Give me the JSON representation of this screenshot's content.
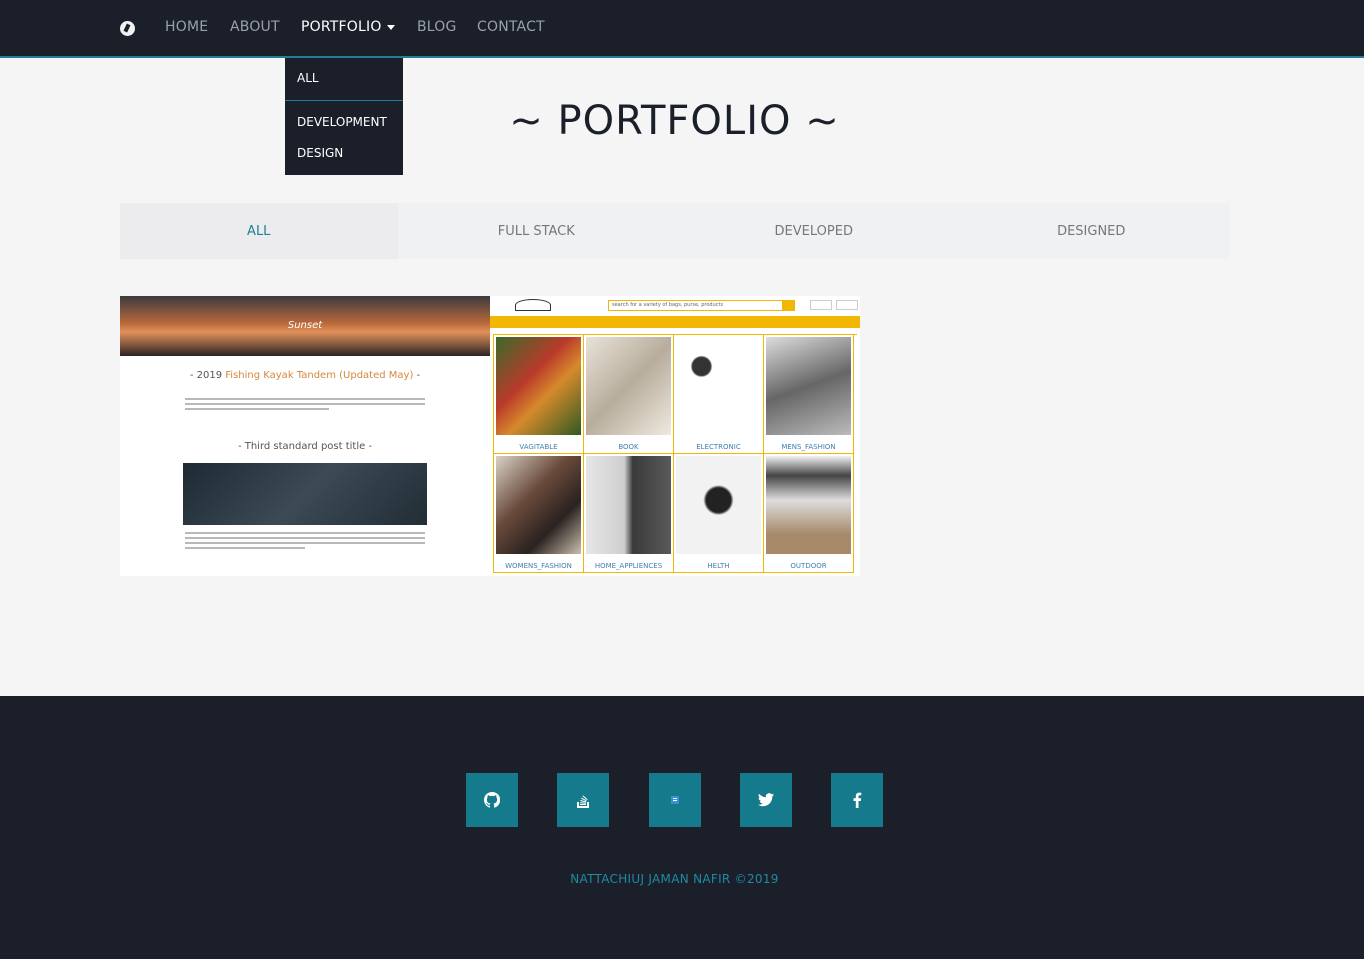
{
  "nav": {
    "logo_icon": "brand-logo-icon",
    "links": [
      "HOME",
      "ABOUT",
      "PORTFOLIO",
      "BLOG",
      "CONTACT"
    ],
    "active": "PORTFOLIO"
  },
  "dropdown": {
    "items": [
      "ALL",
      "DEVELOPMENT",
      "DESIGN"
    ]
  },
  "page": {
    "title": "~ PORTFOLIO ~"
  },
  "filters": {
    "tabs": [
      "ALL",
      "FULL STACK",
      "DEVELOPED",
      "DESIGNED"
    ],
    "active": "ALL"
  },
  "gallery": {
    "blog": {
      "brand": "Sunset",
      "post1_prefix": "- 2019 ",
      "post1_accent": "Fishing Kayak Tandem (Updated May)",
      "post1_suffix": " -",
      "post2": "- Third standard post title -"
    },
    "shop": {
      "search_placeholder": "search for a variety of bags, purse, products",
      "categories": [
        "VAGITABLE",
        "BOOK",
        "ELECTRONIC",
        "MENS_FASHION",
        "WOMENS_FASHION",
        "HOME_APPLIENCES",
        "HELTH",
        "OUTDOOR"
      ]
    }
  },
  "footer": {
    "social": [
      "github-icon",
      "stackoverflow-icon",
      "blog-icon",
      "twitter-icon",
      "facebook-icon"
    ],
    "copyright": "NATTACHIUJ JAMAN NAFIR ©2019"
  },
  "colors": {
    "navbar": "#1b1f2a",
    "accent": "#1f7f94",
    "social_bg": "#157a8c",
    "shop_yellow": "#f2b705"
  }
}
